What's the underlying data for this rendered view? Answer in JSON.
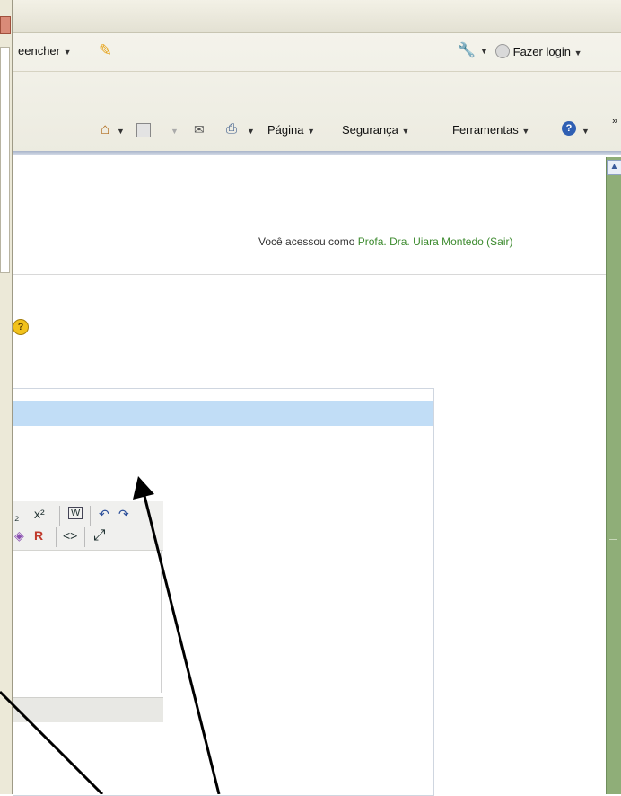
{
  "browser": {
    "toolbar1": {
      "fill_label": "eencher",
      "login_label": "Fazer login"
    },
    "toolbar2": {
      "page_label": "Página",
      "security_label": "Segurança",
      "tools_label": "Ferramentas",
      "overflow": "»"
    }
  },
  "page": {
    "login_text": "Você acessou como",
    "user_name": "Profa. Dra. Uiara Montedo",
    "logout_label": "(Sair)"
  },
  "editor": {
    "toolbar_row1": [
      "₂",
      "x²",
      "W",
      "↶",
      "↷"
    ],
    "toolbar_row2": [
      "◈",
      "R",
      "<>",
      "⤢"
    ]
  }
}
